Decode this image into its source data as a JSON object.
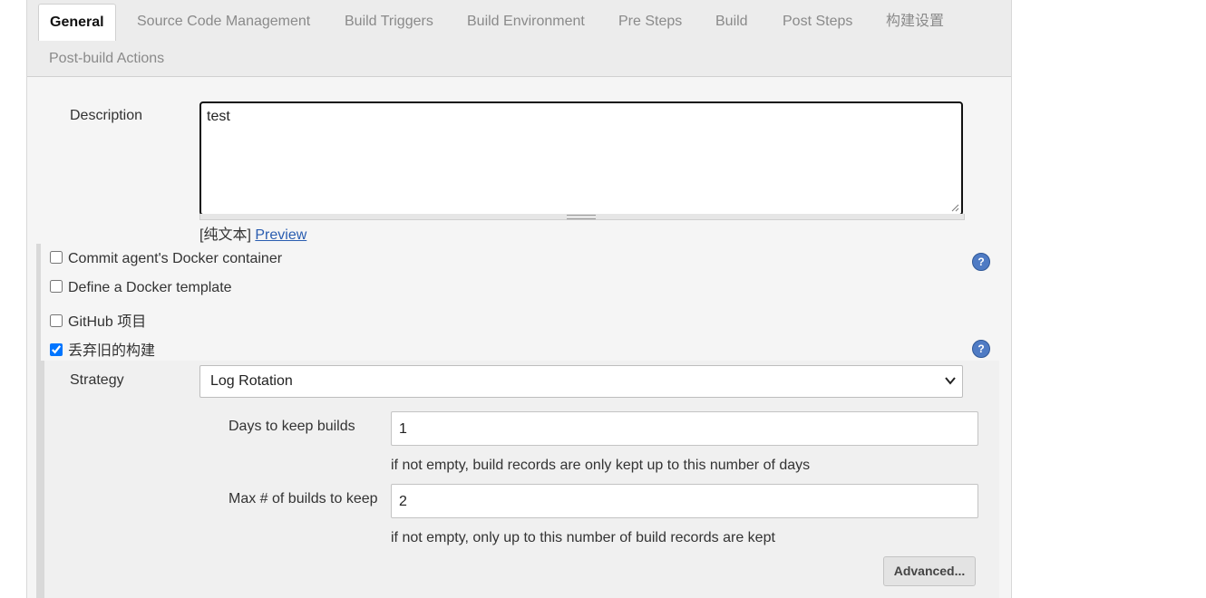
{
  "tabs": [
    {
      "label": "General",
      "active": true
    },
    {
      "label": "Source Code Management"
    },
    {
      "label": "Build Triggers"
    },
    {
      "label": "Build Environment"
    },
    {
      "label": "Pre Steps"
    },
    {
      "label": "Build"
    },
    {
      "label": "Post Steps"
    },
    {
      "label": "构建设置"
    },
    {
      "label": "Post-build Actions"
    }
  ],
  "description": {
    "label": "Description",
    "value": "test",
    "format_label": "[纯文本]",
    "preview_link": "Preview"
  },
  "options": [
    {
      "label": "Commit agent's Docker container",
      "checked": false,
      "has_help": true
    },
    {
      "label": "Define a Docker template",
      "checked": false
    },
    {
      "label": "GitHub 项目",
      "checked": false
    },
    {
      "label": "丢弃旧的构建",
      "checked": true,
      "has_help": true
    }
  ],
  "strategy": {
    "label": "Strategy",
    "selected": "Log Rotation"
  },
  "days_to_keep": {
    "label": "Days to keep builds",
    "value": "1",
    "hint": "if not empty, build records are only kept up to this number of days"
  },
  "max_builds": {
    "label": "Max # of builds to keep",
    "value": "2",
    "hint": "if not empty, only up to this number of build records are kept"
  },
  "advanced_button": "Advanced...",
  "help_glyph": "?",
  "colors": {
    "help_icon": "#4f7bc4",
    "link": "#2a5db0",
    "page_bg": "#f5f5f5"
  }
}
